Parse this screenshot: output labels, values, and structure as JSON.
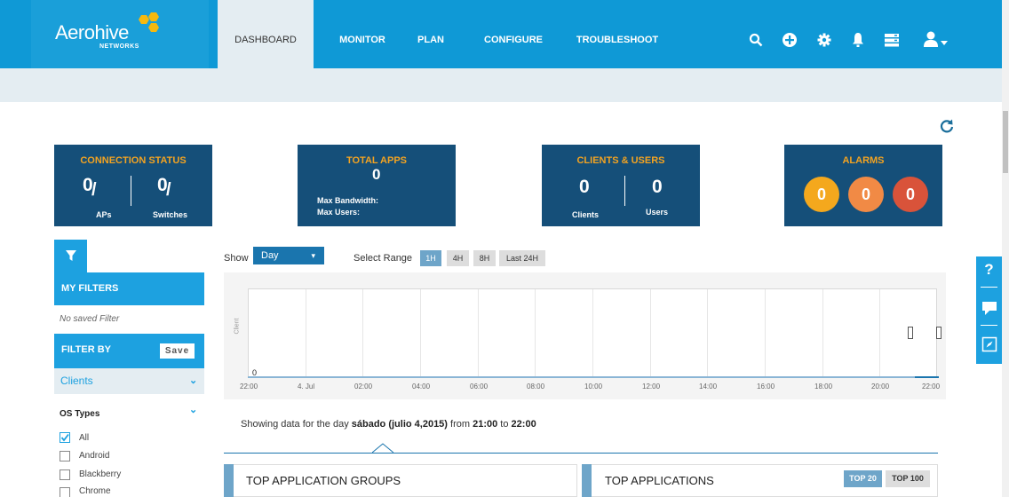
{
  "app": {
    "logo_text": "Aerohive",
    "logo_sub": "NETWORKS"
  },
  "nav": {
    "tabs": [
      "DASHBOARD",
      "MONITOR",
      "PLAN",
      "CONFIGURE",
      "TROUBLESHOOT"
    ],
    "active": "DASHBOARD",
    "icons": [
      "search-icon",
      "add-icon",
      "gear-icon",
      "bell-icon",
      "server-icon",
      "user-icon"
    ]
  },
  "cards": {
    "connection": {
      "title": "CONNECTION STATUS",
      "aps_value": "0",
      "switch_value": "0",
      "aps_label": "APs",
      "switch_label": "Switches"
    },
    "apps": {
      "title": "TOTAL APPS",
      "value": "0",
      "max_bandwidth": "Max Bandwidth:",
      "max_users": "Max Users:"
    },
    "clients": {
      "title": "CLIENTS & USERS",
      "clients_value": "0",
      "users_value": "0",
      "clients_label": "Clients",
      "users_label": "Users"
    },
    "alarms": {
      "title": "ALARMS",
      "values": [
        "0",
        "0",
        "0"
      ],
      "colors": [
        "#f4a81d",
        "#f18a45",
        "#d9533a"
      ]
    }
  },
  "sidebar": {
    "my_filters": "MY FILTERS",
    "no_saved": "No saved Filter",
    "filter_by": "FILTER BY",
    "save": "Save",
    "clients": "Clients",
    "os_types": "OS Types",
    "os_items": [
      {
        "label": "All",
        "checked": true
      },
      {
        "label": "Android",
        "checked": false
      },
      {
        "label": "Blackberry",
        "checked": false
      },
      {
        "label": "Chrome",
        "checked": false
      }
    ]
  },
  "controls": {
    "show_label": "Show",
    "day_value": "Day",
    "range_label": "Select Range",
    "ranges": [
      "1H",
      "4H",
      "8H",
      "Last 24H"
    ],
    "active_range": "1H"
  },
  "chart_data": {
    "type": "area",
    "ylabel": "Client",
    "x": [
      "22:00",
      "4. Jul",
      "02:00",
      "04:00",
      "06:00",
      "08:00",
      "10:00",
      "12:00",
      "14:00",
      "16:00",
      "18:00",
      "20:00",
      "22:00"
    ],
    "values": [
      0,
      0,
      0,
      0,
      0,
      0,
      0,
      0,
      0,
      0,
      0,
      0,
      0
    ],
    "y_tick": "0"
  },
  "showing": {
    "prefix": "Showing data for the day",
    "day": "sábado (julio 4,2015)",
    "from_label": "from",
    "from": "21:00",
    "to_label": "to",
    "to": "22:00"
  },
  "tables": {
    "groups_title": "TOP APPLICATION GROUPS",
    "apps_title": "TOP APPLICATIONS",
    "top20": "TOP 20",
    "top100": "TOP 100"
  },
  "help": [
    "?",
    "chat-icon",
    "compass-icon"
  ]
}
